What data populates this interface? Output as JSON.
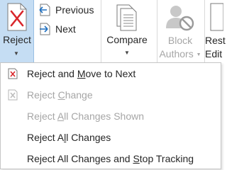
{
  "ribbon": {
    "reject": {
      "label_pre": "Re",
      "label_mnemonic": "j",
      "label_post": "ect"
    },
    "previous": {
      "label": "Previous"
    },
    "next": {
      "label": "Next"
    },
    "compare": {
      "label": "Compare"
    },
    "block_authors": {
      "line1": "Block",
      "line2": "Authors"
    },
    "restrict": {
      "line1": "Rest",
      "line2": "Edit"
    }
  },
  "menu": {
    "items": [
      {
        "pre": "Reject and ",
        "mnemonic": "M",
        "post": "ove to Next",
        "enabled": true
      },
      {
        "pre": "Reject ",
        "mnemonic": "C",
        "post": "hange",
        "enabled": false
      },
      {
        "pre": "Reject ",
        "mnemonic": "A",
        "post": "ll Changes Shown",
        "enabled": false
      },
      {
        "pre": "Reject A",
        "mnemonic": "l",
        "post": "l Changes",
        "enabled": true
      },
      {
        "pre": "Reject All Changes and ",
        "mnemonic": "S",
        "post": "top Tracking",
        "enabled": true
      }
    ]
  },
  "colors": {
    "accent": "#c5ddf3",
    "reject_red": "#d9262b",
    "disabled": "#a6a6a6"
  }
}
